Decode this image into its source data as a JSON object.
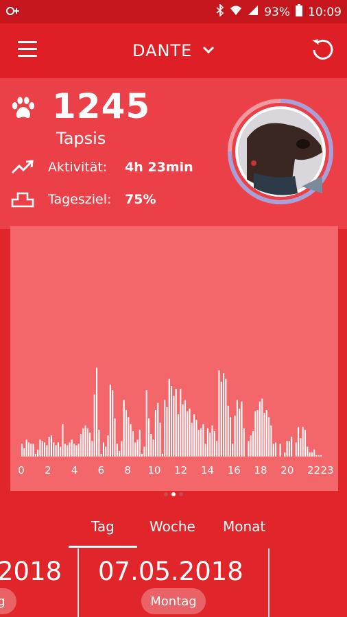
{
  "status_bar": {
    "battery": "93%",
    "time": "10:09"
  },
  "header": {
    "dog_name": "DANTE"
  },
  "stats": {
    "steps": "1245",
    "steps_unit": "Tapsis",
    "activity_label": "Aktivität:",
    "activity_value": "4h 23min",
    "goal_label": "Tagesziel:",
    "goal_value": "75%",
    "goal_progress": 0.75
  },
  "chart_data": {
    "type": "bar",
    "x_tick_labels": [
      "0",
      "2",
      "4",
      "6",
      "8",
      "10",
      "12",
      "14",
      "16",
      "18",
      "20",
      "22",
      "23"
    ],
    "x_ticks": [
      0,
      2,
      4,
      6,
      8,
      10,
      12,
      14,
      16,
      18,
      20,
      22,
      23
    ],
    "xlim": [
      0,
      23
    ],
    "ylim": [
      0,
      100
    ],
    "values": [
      9,
      6,
      12,
      10,
      9,
      9,
      2,
      5,
      12,
      11,
      10,
      8,
      14,
      15,
      10,
      8,
      10,
      7,
      23,
      9,
      8,
      10,
      12,
      9,
      8,
      9,
      16,
      20,
      22,
      20,
      17,
      11,
      44,
      63,
      19,
      2,
      10,
      7,
      15,
      51,
      47,
      27,
      9,
      4,
      11,
      40,
      33,
      28,
      23,
      18,
      10,
      12,
      19,
      2,
      7,
      47,
      27,
      16,
      12,
      33,
      38,
      24,
      2,
      40,
      35,
      55,
      50,
      43,
      48,
      30,
      48,
      37,
      40,
      32,
      34,
      24,
      30,
      26,
      19,
      20,
      23,
      9,
      20,
      17,
      22,
      18,
      11,
      61,
      53,
      59,
      55,
      36,
      28,
      9,
      29,
      40,
      34,
      39,
      20,
      0,
      11,
      15,
      18,
      32,
      33,
      39,
      41,
      31,
      33,
      28,
      22,
      9,
      10,
      0,
      9,
      0,
      3,
      11,
      11,
      14,
      0,
      10,
      21,
      13,
      21,
      19,
      7,
      3,
      3,
      5,
      1,
      1,
      1,
      0,
      0
    ]
  },
  "pager": {
    "active": 1,
    "count": 3
  },
  "tabs": {
    "day": "Tag",
    "week": "Woche",
    "month": "Monat"
  },
  "dates": {
    "previous": "2018",
    "previous_pill": "g",
    "current": "07.05.2018",
    "current_pill": "Montag"
  }
}
